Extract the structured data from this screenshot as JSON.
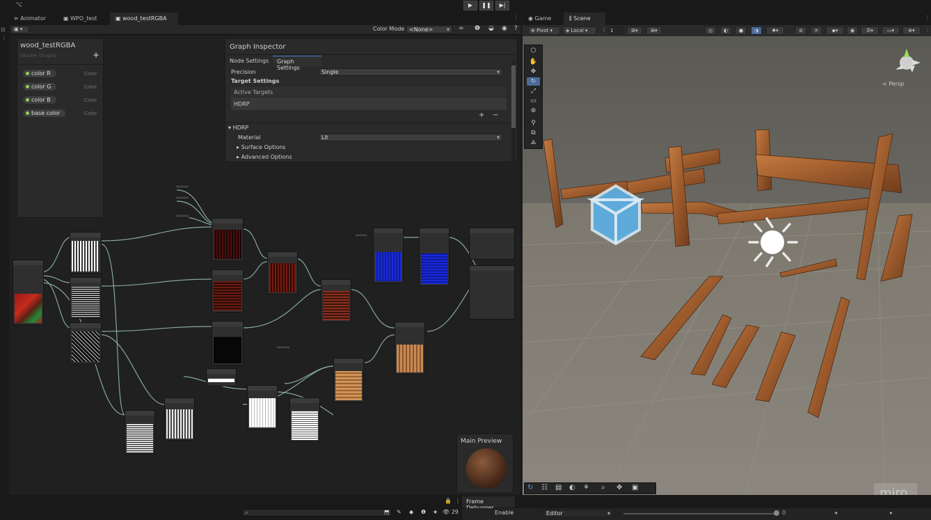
{
  "play": {
    "play_icon": "▶",
    "pause_icon": "❚❚",
    "step_icon": "▶|"
  },
  "left_tabs": [
    {
      "label": "Animator",
      "icon": "animator-icon"
    },
    {
      "label": "WPO_test",
      "icon": "shadergraph-icon"
    },
    {
      "label": "wood_testRGBA",
      "icon": "shadergraph-icon",
      "active": true
    }
  ],
  "right_tabs": [
    {
      "label": "Game",
      "icon": "game-icon"
    },
    {
      "label": "Scene",
      "icon": "scene-icon",
      "active": true
    }
  ],
  "sg_toolbar": {
    "color_mode_label": "Color Mode",
    "color_mode_value": "<None>"
  },
  "blackboard": {
    "title": "wood_testRGBA",
    "subtitle": "Shader Graphs",
    "add": "+",
    "properties": [
      {
        "name": "color R",
        "type": "Color"
      },
      {
        "name": "color G",
        "type": "Color"
      },
      {
        "name": "color B",
        "type": "Color"
      },
      {
        "name": "base color",
        "type": "Color"
      }
    ]
  },
  "inspector": {
    "title": "Graph Inspector",
    "tabs": [
      "Node Settings",
      "Graph Settings"
    ],
    "active_tab": "Graph Settings",
    "precision_label": "Precision",
    "precision_value": "Single",
    "target_settings": "Target Settings",
    "active_targets": "Active Targets",
    "target_item": "HDRP",
    "add": "+",
    "remove": "−",
    "hdrp_section": "HDRP",
    "material_label": "Material",
    "material_value": "Lit",
    "surface_options": "Surface Options",
    "advanced_options": "Advanced Options"
  },
  "main_preview": {
    "title": "Main Preview"
  },
  "scene_toolbar": {
    "pivot": "Pivot",
    "local": "Local",
    "grid_value": "1"
  },
  "scene": {
    "persp": "< Persp",
    "watermark": "miro"
  },
  "status_bar": {
    "frame_debugger": "Frame Debugger",
    "enable": "Enable",
    "editor": "Editor",
    "slider_value": "0",
    "count": "29"
  },
  "colors": {
    "accent": "#4a7ccf",
    "wood": "#b06a34",
    "sky": "#60605a",
    "ground": "#7d7a72"
  }
}
